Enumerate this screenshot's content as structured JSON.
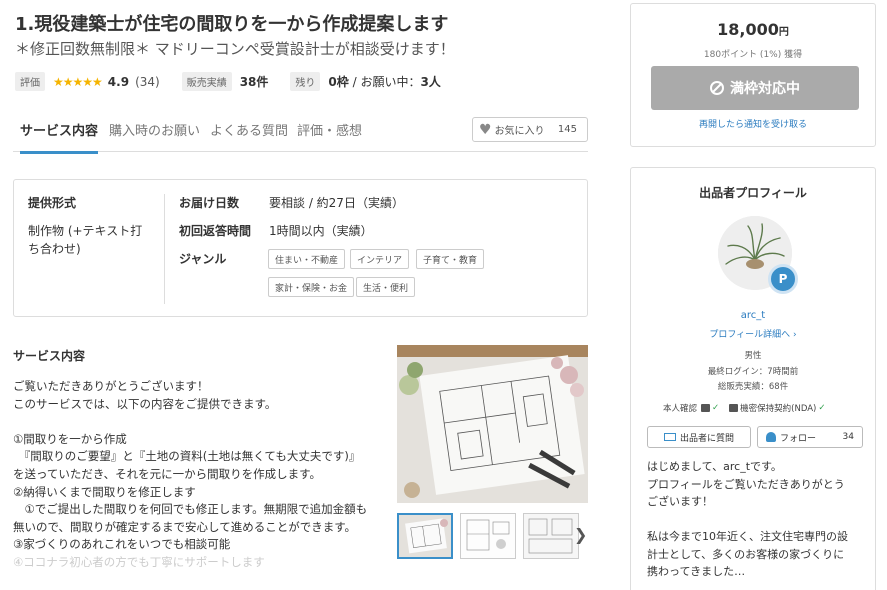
{
  "header": {
    "title": "1.現役建築士が住宅の間取りを一から作成提案します",
    "subtitle": "＊修正回数無制限＊ マドリーコンペ受賞設計士が相談受けます！"
  },
  "stats": {
    "rating_label": "評価",
    "stars": "★★★★★",
    "rating": "4.9",
    "rating_count": "(34)",
    "sales_label": "販売実績",
    "sales_value": "38件",
    "remaining_label": "残り",
    "remaining_value": "0枠",
    "remaining_sep": " / お願い中：",
    "in_progress": "3人"
  },
  "tabs": {
    "items": [
      "サービス内容",
      "購入時のお願い",
      "よくある質問",
      "評価・感想"
    ],
    "active_index": 0
  },
  "favorite": {
    "label": "お気に入り",
    "count": "145"
  },
  "spec": {
    "format_label": "提供形式",
    "format_value_1": "制作物 (+テキスト打",
    "format_value_2": "ち合わせ)",
    "delivery_label": "お届け日数",
    "delivery_value": "要相談 / 約27日（実績）",
    "reply_label": "初回返答時間",
    "reply_value": "1時間以内（実績）",
    "genre_label": "ジャンル",
    "genres": [
      "住まい・不動産",
      "インテリア",
      "子育て・教育",
      "家計・保険・お金",
      "生活・便利"
    ]
  },
  "service": {
    "title": "サービス内容",
    "lines": [
      "ご覧いただきありがとうございます！",
      "このサービスでは、以下の内容をご提供できます。",
      "",
      "①間取りを一から作成",
      "　『間取りのご要望』と『土地の資料(土地は無くても大丈夫です)』",
      "を送っていただき、それを元に一から間取りを作成します。",
      "②納得いくまで間取りを修正します",
      "　①でご提出した間取りを何回でも修正します。無期限で追加金額も",
      "無いので、間取りが確定するまで安心して進めることができます。",
      "③家づくりのあれこれをいつでも相談可能"
    ],
    "faded_line": "④ココナラ初心者の方でも丁寧にサポートします"
  },
  "gallery": {
    "next_icon": "chevron-right-icon"
  },
  "purchase": {
    "price": "18,000",
    "currency": "円",
    "points": "180ポイント (1%) 獲得",
    "full_button": "満枠対応中",
    "notify_link": "再開したら通知を受け取る"
  },
  "profile": {
    "title": "出品者プロフィール",
    "badge": "P",
    "username": "arc_t",
    "detail_link": "プロフィール詳細へ",
    "gender": "男性",
    "last_login": "最終ログイン：7時間前",
    "total_sales": "総販売実績：68件",
    "id_verified": "本人確認",
    "nda": "機密保持契約(NDA)",
    "message_button": "出品者に質問",
    "follow_button": "フォロー",
    "follow_count": "34",
    "message_lines": [
      "はじめまして、arc_tです。",
      "プロフィールをご覧いただきありがとう",
      "ございます！",
      "",
      "私は今まで10年近く、注文住宅専門の設",
      "計士として、多くのお客様の家づくりに",
      "携わってきました…"
    ]
  },
  "colors": {
    "accent": "#3a8fc9",
    "star": "#f5b400",
    "disabled_button": "#aaaaaa",
    "link": "#2a7bbf",
    "check": "#2e9e4a"
  }
}
